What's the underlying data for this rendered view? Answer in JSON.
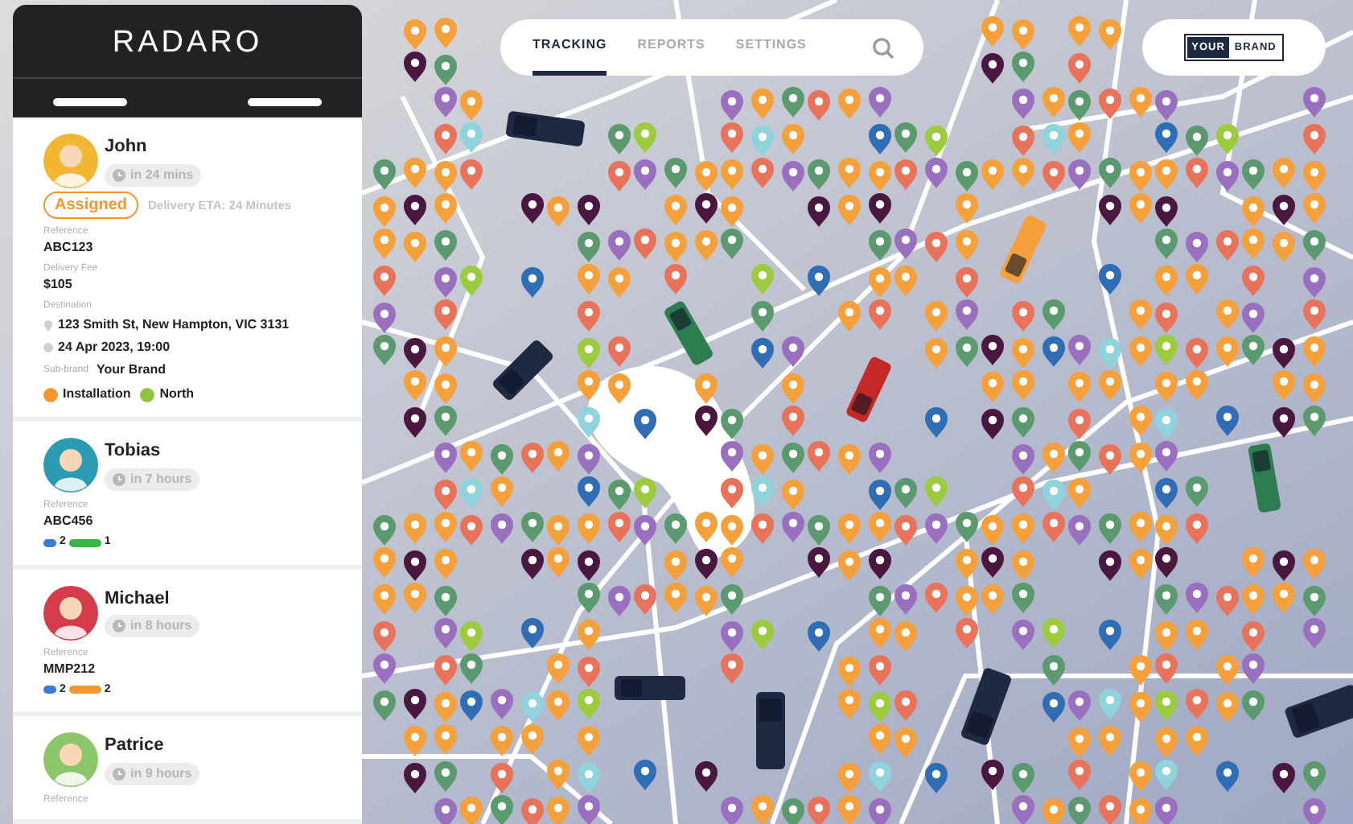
{
  "brand": {
    "logo": "RADARO"
  },
  "nav": {
    "tabs": [
      {
        "label": "TRACKING",
        "selected": true
      },
      {
        "label": "REPORTS",
        "selected": false
      },
      {
        "label": "SETTINGS",
        "selected": false
      }
    ]
  },
  "partner_logo": {
    "left": "YOUR",
    "right": "BRAND"
  },
  "drivers": [
    {
      "name": "John",
      "eta": "in 24 mins",
      "status": "Assigned",
      "status_note": "Delivery ETA: 24 Minutes",
      "fields": [
        {
          "label": "Reference",
          "value": "ABC123"
        },
        {
          "label": "Delivery Fee",
          "value": "$105"
        }
      ],
      "destination": {
        "label": "Destination",
        "address": "123 Smith St, New Hampton, VIC 3131",
        "time": "24 Apr 2023, 19:00"
      },
      "sub_brand": {
        "label": "Sub-brand",
        "value": "Your Brand"
      },
      "tags": [
        {
          "label": "Installation",
          "color": "#f7952e"
        },
        {
          "label": "North",
          "color": "#8cc63f"
        }
      ]
    },
    {
      "name": "Tobias",
      "eta": "in 7 hours",
      "fields": [
        {
          "label": "Reference",
          "value": "ABC456"
        }
      ],
      "counts": [
        {
          "value": "2",
          "color": "#3a7bd5",
          "kind": "short"
        },
        {
          "value": "1",
          "color": "#3bb54a",
          "kind": "long"
        }
      ]
    },
    {
      "name": "Michael",
      "eta": "in 8 hours",
      "fields": [
        {
          "label": "Reference",
          "value": "MMP212"
        }
      ],
      "counts": [
        {
          "value": "2",
          "color": "#3a7bd5",
          "kind": "short"
        },
        {
          "value": "2",
          "color": "#f7952e",
          "kind": "long"
        }
      ]
    },
    {
      "name": "Patrice",
      "eta": "in 9 hours",
      "fields": [
        {
          "label": "Reference"
        }
      ]
    }
  ]
}
